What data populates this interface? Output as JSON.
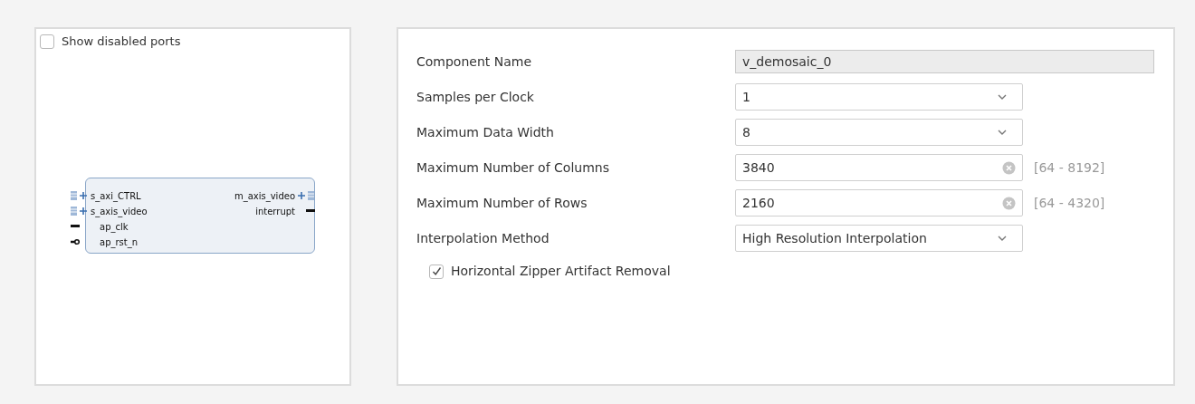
{
  "show_disabled_ports": {
    "label": "Show disabled ports",
    "checked": false
  },
  "block": {
    "left_ports": [
      {
        "name": "s_axi_CTRL",
        "kind": "bus"
      },
      {
        "name": "s_axis_video",
        "kind": "bus"
      },
      {
        "name": "ap_clk",
        "kind": "wire"
      },
      {
        "name": "ap_rst_n",
        "kind": "inverted"
      }
    ],
    "right_ports": [
      {
        "name": "m_axis_video",
        "kind": "bus"
      },
      {
        "name": "interrupt",
        "kind": "wire"
      }
    ]
  },
  "fields": [
    {
      "label": "Component Name",
      "kind": "readonly",
      "value": "v_demosaic_0"
    },
    {
      "label": "Samples per Clock",
      "kind": "select",
      "value": "1"
    },
    {
      "label": "Maximum Data Width",
      "kind": "select",
      "value": "8"
    },
    {
      "label": "Maximum Number of Columns",
      "kind": "number",
      "value": "3840",
      "range": "[64 - 8192]"
    },
    {
      "label": "Maximum Number of Rows",
      "kind": "number",
      "value": "2160",
      "range": "[64 - 4320]"
    },
    {
      "label": "Interpolation Method",
      "kind": "select",
      "value": "High Resolution Interpolation"
    }
  ],
  "zipper_removal": {
    "label": "Horizontal Zipper Artifact Removal",
    "checked": true
  }
}
